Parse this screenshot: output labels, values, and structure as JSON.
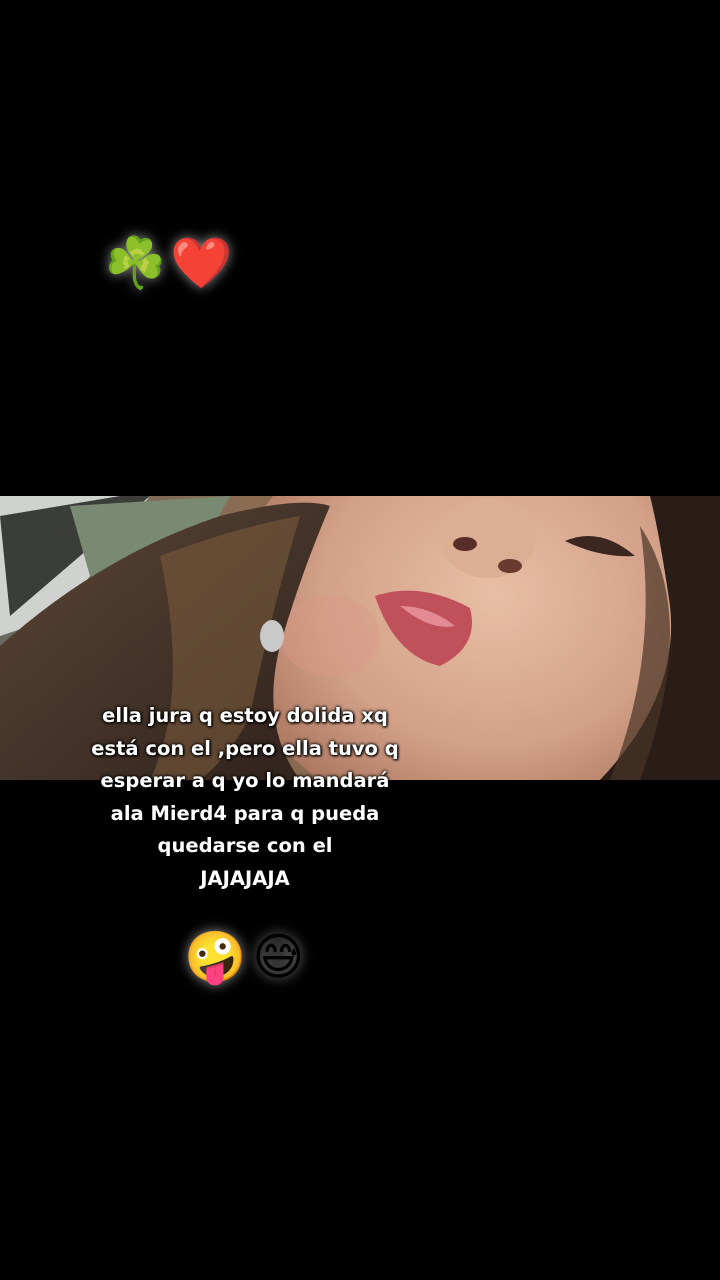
{
  "top_emojis": [
    "☘️",
    "❤️"
  ],
  "caption_lines": [
    "ella jura q estoy dolida xq",
    "está con el ,pero ella tuvo q",
    "esperar a q yo lo mandará",
    "ala Mierd4 para q pueda",
    "quedarse con el",
    "JAJAJAJA"
  ],
  "bottom_emojis": [
    "🤪",
    "😅"
  ]
}
